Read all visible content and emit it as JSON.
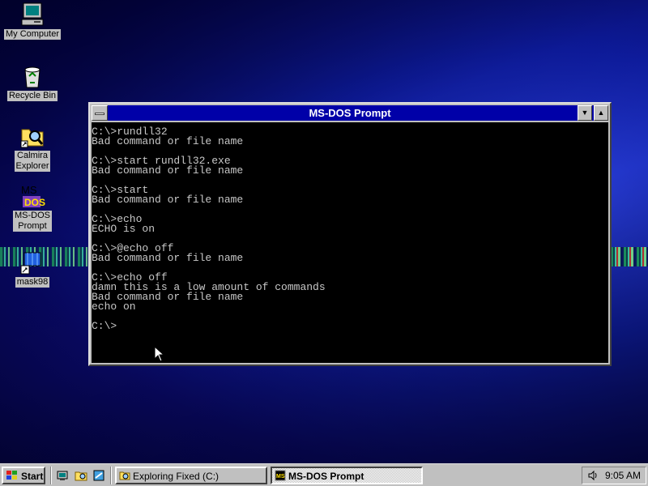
{
  "desktop": {
    "icons": [
      {
        "label": "My Computer",
        "icon": "computer-icon"
      },
      {
        "label": "Recycle Bin",
        "icon": "recycle-bin-icon"
      },
      {
        "label": "Calmira\nExplorer",
        "icon": "explorer-icon"
      },
      {
        "label": "MS-DOS\nPrompt",
        "icon": "msdos-icon"
      },
      {
        "label": "mask98",
        "icon": "mask98-icon"
      }
    ]
  },
  "window": {
    "title": "MS-DOS Prompt",
    "console_lines": [
      "C:\\>rundll32",
      "Bad command or file name",
      "",
      "C:\\>start rundll32.exe",
      "Bad command or file name",
      "",
      "C:\\>start",
      "Bad command or file name",
      "",
      "C:\\>echo",
      "ECHO is on",
      "",
      "C:\\>@echo off",
      "Bad command or file name",
      "",
      "C:\\>echo off",
      "damn this is a low amount of commands",
      "Bad command or file name",
      "echo on",
      "",
      "C:\\>"
    ]
  },
  "taskbar": {
    "start_label": "Start",
    "tasks": [
      {
        "label": "Exploring Fixed (C:)",
        "active": false
      },
      {
        "label": "MS-DOS Prompt",
        "active": true
      }
    ],
    "clock": "9:05 AM"
  },
  "colors": {
    "title_bar": "#0000a8",
    "console_bg": "#000000",
    "console_fg": "#c8c8c8",
    "chrome": "#c0c0c0"
  }
}
